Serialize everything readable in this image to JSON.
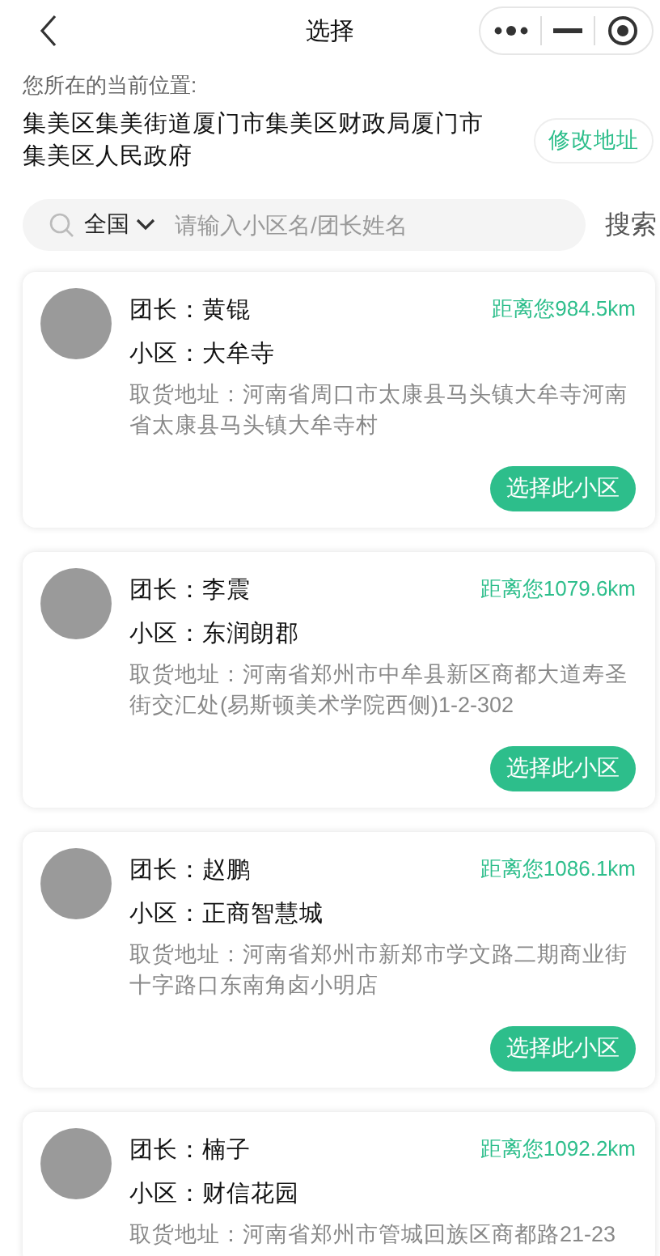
{
  "nav": {
    "title": "选择"
  },
  "location": {
    "label": "您所在的当前位置:",
    "address": "集美区集美街道厦门市集美区财政局厦门市集美区人民政府",
    "change_button": "修改地址"
  },
  "search": {
    "region": "全国",
    "placeholder": "请输入小区名/团长姓名",
    "button": "搜索"
  },
  "leaders": [
    {
      "leader": "团长：黄锟",
      "community": "小区：大牟寺",
      "distance": "距离您984.5km",
      "address": "取货地址：河南省周口市太康县马头镇大牟寺河南省太康县马头镇大牟寺村",
      "button": "选择此小区"
    },
    {
      "leader": "团长：李震",
      "community": "小区：东润朗郡",
      "distance": "距离您1079.6km",
      "address": "取货地址：河南省郑州市中牟县新区商都大道寿圣街交汇处(易斯顿美术学院西侧)1-2-302",
      "button": "选择此小区"
    },
    {
      "leader": "团长：赵鹏",
      "community": "小区：正商智慧城",
      "distance": "距离您1086.1km",
      "address": "取货地址：河南省郑州市新郑市学文路二期商业街十字路口东南角卤小明店",
      "button": "选择此小区"
    },
    {
      "leader": "团长：楠子",
      "community": "小区：财信花园",
      "distance": "距离您1092.2km",
      "address": "取货地址：河南省郑州市管城回族区商都路21-23"
    }
  ]
}
